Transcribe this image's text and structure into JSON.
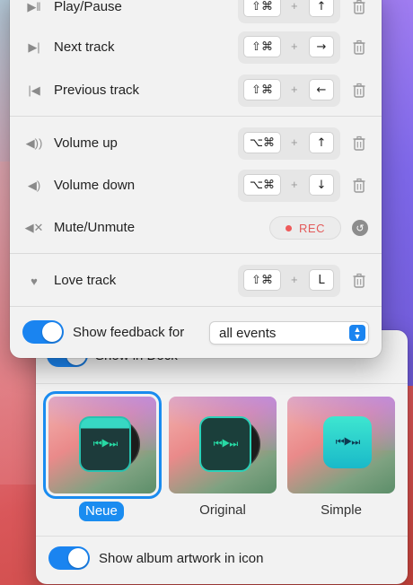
{
  "shortcuts": {
    "rows": [
      {
        "label": "Play/Pause",
        "icon": "play-pause-icon",
        "modifiers": "⇧⌘",
        "key": "↑"
      },
      {
        "label": "Next track",
        "icon": "next-track-icon",
        "modifiers": "⇧⌘",
        "key": "→"
      },
      {
        "label": "Previous track",
        "icon": "previous-track-icon",
        "modifiers": "⇧⌘",
        "key": "←"
      },
      {
        "label": "Volume up",
        "icon": "volume-up-icon",
        "modifiers": "⌥⌘",
        "key": "↑"
      },
      {
        "label": "Volume down",
        "icon": "volume-down-icon",
        "modifiers": "⌥⌘",
        "key": "↓"
      },
      {
        "label": "Mute/Unmute",
        "icon": "mute-icon",
        "record_label": "REC"
      },
      {
        "label": "Love track",
        "icon": "heart-icon",
        "modifiers": "⇧⌘",
        "key": "L"
      }
    ],
    "plus": "+",
    "feedback_label": "Show feedback for",
    "feedback_value": "all events"
  },
  "icon_chooser": {
    "dock_label": "Show in Dock",
    "options": [
      {
        "label": "Neue",
        "selected": true
      },
      {
        "label": "Original",
        "selected": false
      },
      {
        "label": "Simple",
        "selected": false
      }
    ],
    "artwork_label": "Show album artwork in icon"
  },
  "colors": {
    "accent": "#1a84f0",
    "record": "#ee5a5a"
  }
}
